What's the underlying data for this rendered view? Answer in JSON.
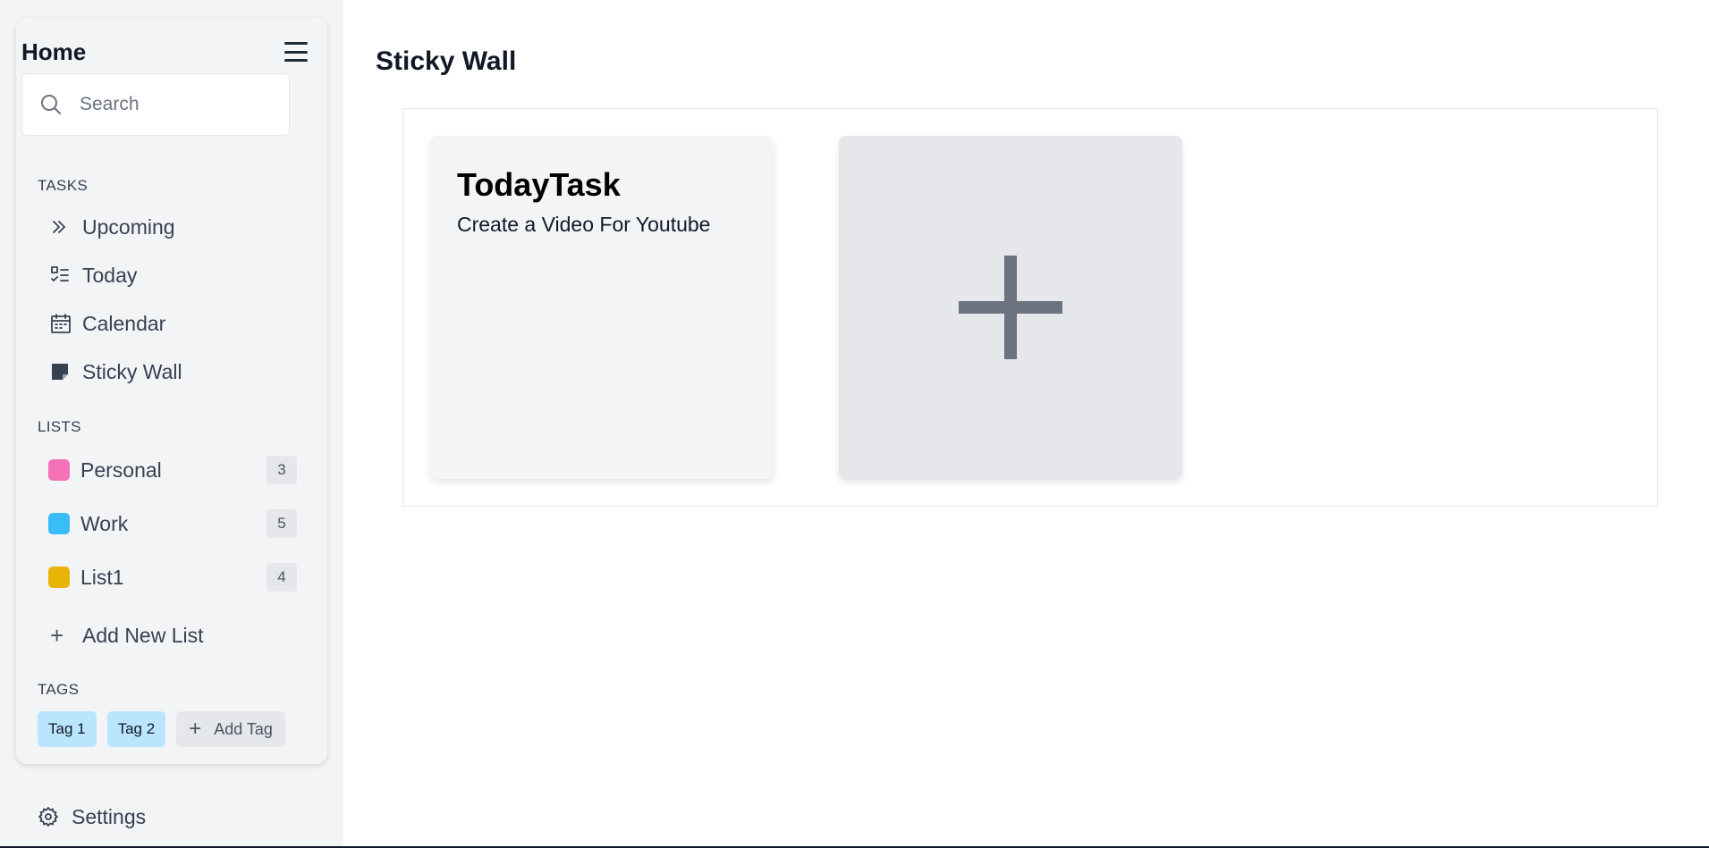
{
  "sidebar": {
    "title": "Home",
    "search": {
      "placeholder": "Search"
    },
    "tasks_label": "TASKS",
    "tasks": [
      {
        "label": "Upcoming",
        "icon": "chevrons-right-icon"
      },
      {
        "label": "Today",
        "icon": "checklist-icon"
      },
      {
        "label": "Calendar",
        "icon": "calendar-icon"
      },
      {
        "label": "Sticky Wall",
        "icon": "sticky-note-icon"
      }
    ],
    "lists_label": "LISTS",
    "lists": [
      {
        "label": "Personal",
        "count": "3",
        "color": "#f472b6"
      },
      {
        "label": "Work",
        "count": "5",
        "color": "#38bdf8"
      },
      {
        "label": "List1",
        "count": "4",
        "color": "#eab308"
      }
    ],
    "add_list_label": "Add New List",
    "tags_label": "TAGS",
    "tags": [
      {
        "label": "Tag 1",
        "color": "#bae6fd"
      },
      {
        "label": "Tag 2",
        "color": "#bae6fd"
      }
    ],
    "add_tag_label": "Add Tag",
    "settings_label": "Settings"
  },
  "main": {
    "title": "Sticky Wall",
    "notes": [
      {
        "title": "TodayTask",
        "text": "Create a Video For Youtube"
      }
    ]
  }
}
